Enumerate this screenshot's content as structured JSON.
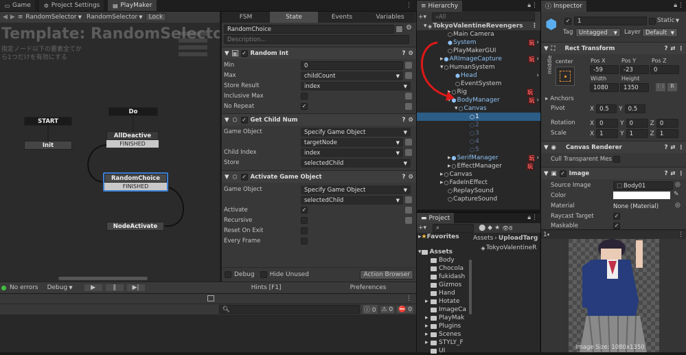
{
  "top_tabs": {
    "game": "Game",
    "project_settings": "Project Settings",
    "playmaker": "PlayMaker"
  },
  "pm_toolbar": {
    "fsm_select": "RandomSelector",
    "state_select": "RandomSelector",
    "lock": "Lock"
  },
  "graph": {
    "title": "Template: RandomSelector",
    "description": "指定ノード以下の要素全てか\nら1つだけを有効にする",
    "start": "START",
    "init": "Init",
    "do": "Do",
    "all_deactive": "AllDeactive",
    "finished1": "FINISHED",
    "random_choice": "RandomChoice",
    "finished2": "FINISHED",
    "node_activate": "NodeActivate"
  },
  "fsm_tabs": {
    "fsm": "FSM",
    "state": "State",
    "events": "Events",
    "variables": "Variables"
  },
  "state_panel": {
    "state_name": "RandomChoice",
    "description_placeholder": "Description...",
    "action1": {
      "title": "Random Int",
      "min_label": "Min",
      "min_value": "0",
      "max_label": "Max",
      "max_value": "childCount",
      "store_label": "Store Result",
      "store_value": "index",
      "inclusive_label": "Inclusive Max",
      "norepeat_label": "No Repeat"
    },
    "action2": {
      "title": "Get Child Num",
      "go_label": "Game Object",
      "go_value": "Specify Game Object",
      "go_var": "targetNode",
      "ci_label": "Child Index",
      "ci_value": "index",
      "store_label": "Store",
      "store_value": "selectedChild"
    },
    "action3": {
      "title": "Activate Game Object",
      "go_label": "Game Object",
      "go_value": "Specify Game Object",
      "go_var": "selectedChild",
      "activate_label": "Activate",
      "recursive_label": "Recursive",
      "reset_label": "Reset On Exit",
      "every_label": "Every Frame"
    },
    "debug_label": "Debug",
    "hide_unused_label": "Hide Unused",
    "action_browser": "Action Browser"
  },
  "status_bar": {
    "errors": "No errors",
    "debug": "Debug",
    "hints": "Hints [F1]",
    "preferences": "Preferences"
  },
  "console": {
    "count1": "0",
    "count2": "0",
    "count3": "0"
  },
  "hierarchy": {
    "tab": "Hierarchy",
    "search_placeholder": "All",
    "items": {
      "scene": "TokyoValentineRevengers",
      "main_camera": "Main Camera",
      "system": "System",
      "playmaker_gui": "PlayMakerGUI",
      "ar_image": "ARImageCapture",
      "human_system": "HumanSystem",
      "head": "Head",
      "event_system": "EventSystem",
      "rig": "Rig",
      "body_manager": "BodyManager",
      "canvas_child": "Canvas",
      "c1": "1",
      "c2": "2",
      "c3": "3",
      "c4": "4",
      "c5": "5",
      "serif_manager": "SerifManager",
      "effect_manager": "EffectManager",
      "canvas": "Canvas",
      "fade_in": "FadeInEffect",
      "replay_sound": "ReplaySound",
      "capture_sound": "CaptureSound"
    },
    "badge": "玩"
  },
  "project": {
    "tab": "Project",
    "favorites": "Favorites",
    "assets": "Assets",
    "folders": [
      "Body",
      "Chocola",
      "fukidash",
      "Gizmos",
      "Hand",
      "Hotate",
      "ImageCa",
      "PlayMak",
      "Plugins",
      "Scenes",
      "STYLY_F",
      "UI"
    ],
    "breadcrumb_assets": "Assets",
    "breadcrumb_folder": "UploadTarg",
    "file": "TokyoValentineR",
    "count": "8"
  },
  "inspector": {
    "tab": "Inspector",
    "name": "1",
    "static": "Static",
    "tag_label": "Tag",
    "tag_value": "Untagged",
    "layer_label": "Layer",
    "layer_value": "Default",
    "rect_transform": "Rect Transform",
    "anchor_h": "center",
    "anchor_v": "middle",
    "posx_label": "Pos X",
    "posy_label": "Pos Y",
    "posz_label": "Pos Z",
    "posx": "-59",
    "posy": "-23",
    "posz": "0",
    "width_label": "Width",
    "height_label": "Height",
    "width": "1080",
    "height": "1350",
    "anchors": "Anchors",
    "pivot_label": "Pivot",
    "pivot_x": "0.5",
    "pivot_y": "0.5",
    "rotation_label": "Rotation",
    "rot_x": "0",
    "rot_y": "0",
    "rot_z": "0",
    "scale_label": "Scale",
    "scale_x": "1",
    "scale_y": "1",
    "scale_z": "1",
    "canvas_renderer": "Canvas Renderer",
    "cull_label": "Cull Transparent Mes",
    "image": "Image",
    "source_label": "Source Image",
    "source_value": "Body01",
    "color_label": "Color",
    "material_label": "Material",
    "material_value": "None (Material)",
    "raycast_label": "Raycast Target",
    "maskable_label": "Maskable",
    "preview_caption": "Image Size: 1080x1350",
    "preview_index": "1"
  },
  "colors": {
    "accent": "#2c5d87",
    "selection": "#2c5d87",
    "red_arrow": "#e01818"
  }
}
